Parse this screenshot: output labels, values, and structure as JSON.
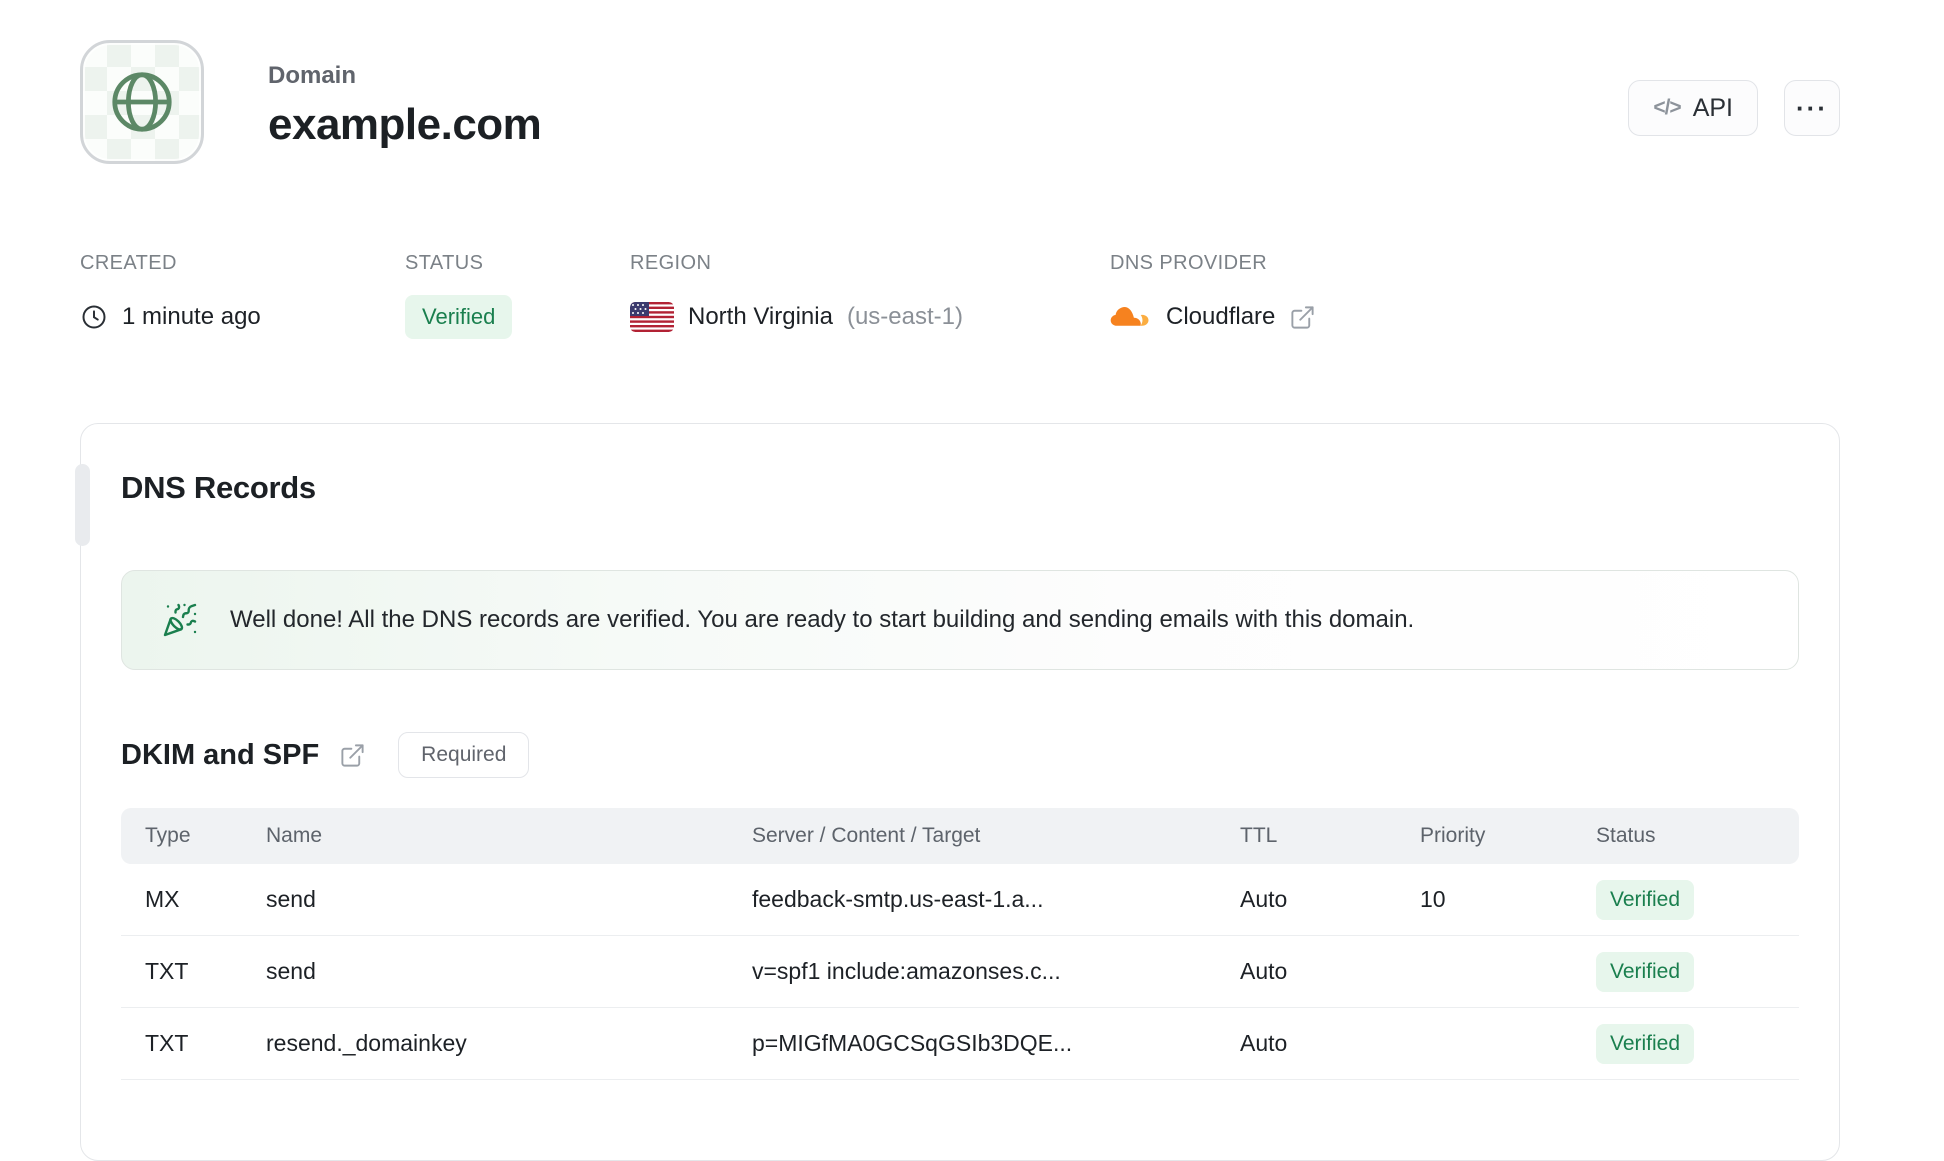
{
  "header": {
    "label": "Domain",
    "title": "example.com",
    "api_button": "API",
    "api_icon": "</>",
    "menu_button": "···"
  },
  "meta": {
    "created": {
      "label": "CREATED",
      "value": "1 minute ago"
    },
    "status": {
      "label": "STATUS",
      "value": "Verified"
    },
    "region": {
      "label": "REGION",
      "value": "North Virginia",
      "code": "(us-east-1)"
    },
    "dns_provider": {
      "label": "DNS PROVIDER",
      "value": "Cloudflare"
    }
  },
  "dns_records": {
    "title": "DNS Records",
    "banner": "Well done! All the DNS records are verified. You are ready to start building and sending emails with this domain.",
    "section": {
      "title": "DKIM and SPF",
      "badge": "Required"
    },
    "table": {
      "headers": [
        "Type",
        "Name",
        "Server / Content / Target",
        "TTL",
        "Priority",
        "Status"
      ],
      "rows": [
        {
          "type": "MX",
          "name": "send",
          "content": "feedback-smtp.us-east-1.a...",
          "ttl": "Auto",
          "priority": "10",
          "status": "Verified"
        },
        {
          "type": "TXT",
          "name": "send",
          "content": "v=spf1 include:amazonses.c...",
          "ttl": "Auto",
          "priority": "",
          "status": "Verified"
        },
        {
          "type": "TXT",
          "name": "resend._domainkey",
          "content": "p=MIGfMA0GCSqGSIb3DQE...",
          "ttl": "Auto",
          "priority": "",
          "status": "Verified"
        }
      ]
    }
  },
  "icons": {
    "avatar": "globe-icon",
    "created": "clock-icon",
    "region": "us-flag-icon",
    "dns_provider": "cloudflare-icon",
    "provider_link": "external-link-icon",
    "banner": "party-popper-icon",
    "section_link": "external-link-icon",
    "api": "code-icon",
    "menu": "ellipsis-icon"
  },
  "colors": {
    "status_green": "#1a7f4e",
    "status_green_bg": "#e7f6ec",
    "globe_green": "#5c8866",
    "cloudflare_orange": "#f6821f",
    "cloudflare_light_orange": "#fbad41",
    "text_primary": "#1c2024",
    "text_muted": "#7b8187"
  }
}
